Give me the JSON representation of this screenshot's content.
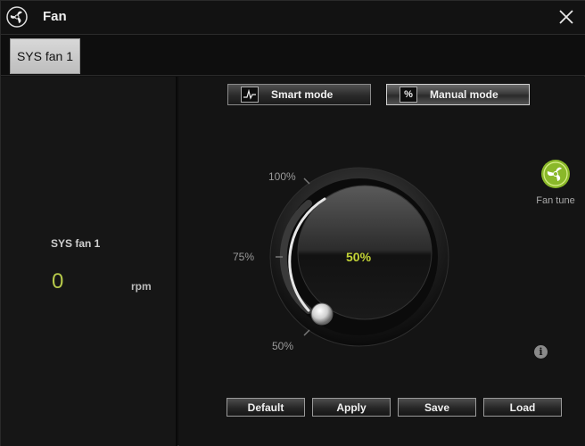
{
  "window": {
    "title": "Fan"
  },
  "tabs": [
    {
      "label": "SYS fan 1"
    }
  ],
  "left_panel": {
    "fan_name": "SYS fan 1",
    "rpm_value": "0",
    "rpm_unit": "rpm"
  },
  "modes": {
    "smart_label": "Smart mode",
    "manual_label": "Manual mode",
    "manual_icon": "%",
    "selected": "Manual mode"
  },
  "dial": {
    "value_label": "50%",
    "value_fraction": 0.5,
    "min_label": "50%",
    "mid_label": "75%",
    "max_label": "100%"
  },
  "fan_tune": {
    "label": "Fan tune"
  },
  "info": {
    "glyph": "i"
  },
  "buttons": {
    "default": "Default",
    "apply": "Apply",
    "save": "Save",
    "load": "Load"
  },
  "colors": {
    "accent": "#b6c84a",
    "value_green": "#c3d436",
    "fan_tune_green": "#8ab82a"
  }
}
